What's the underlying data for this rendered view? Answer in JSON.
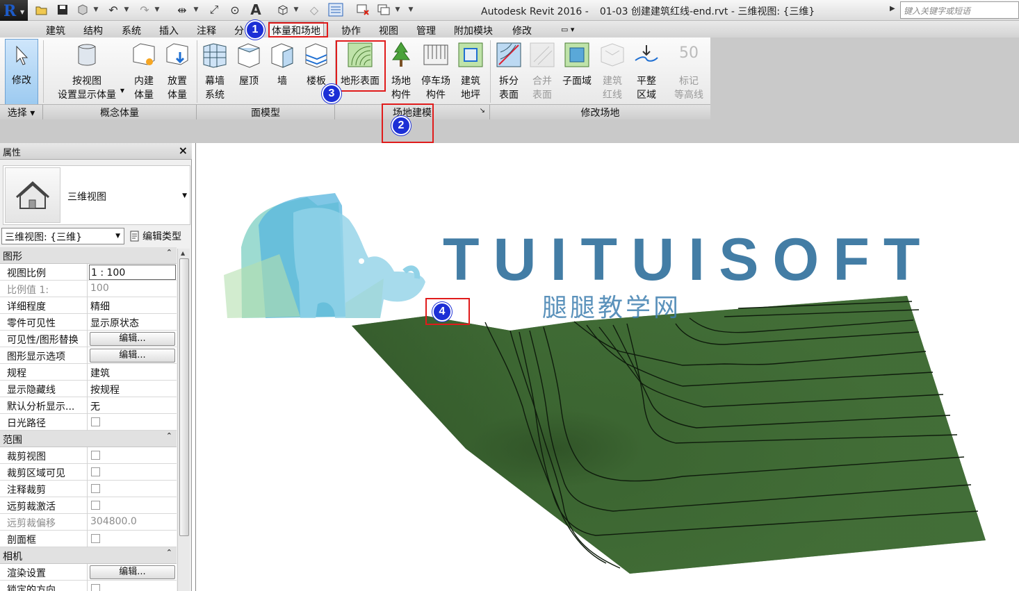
{
  "titlebar": {
    "app_name": "Autodesk Revit 2016 -",
    "file": "01-03 创建建筑红线-end.rvt - 三维视图: {三维}",
    "search_placeholder": "键入关键字或短语"
  },
  "menu_tabs": [
    "建筑",
    "结构",
    "系统",
    "插入",
    "注释",
    "分",
    "体量和场地",
    "协作",
    "视图",
    "管理",
    "附加模块",
    "修改"
  ],
  "ribbon": {
    "modify": "修改",
    "select_group": "选择",
    "conceptual_mass": {
      "group": "概念体量",
      "show_mass": [
        "按视图",
        "设置显示体量"
      ],
      "inplace_mass": [
        "内建",
        "体量"
      ],
      "place_mass": [
        "放置",
        "体量"
      ]
    },
    "face_model": {
      "group": "面模型",
      "curtain": [
        "幕墙",
        "系统"
      ],
      "roof": "屋顶",
      "wall": "墙",
      "floor": "楼板"
    },
    "site_modeling": {
      "group": "场地建模",
      "toposurface": "地形表面",
      "site_component": [
        "场地",
        "构件"
      ],
      "parking": [
        "停车场",
        "构件"
      ],
      "pad": [
        "建筑",
        "地坪"
      ]
    },
    "modify_site": {
      "group": "修改场地",
      "split": [
        "拆分",
        "表面"
      ],
      "merge": [
        "合并",
        "表面"
      ],
      "subregion": "子面域",
      "property_line": [
        "建筑",
        "红线"
      ],
      "grade": [
        "平整",
        "区域"
      ],
      "label_contours": [
        "标记",
        "等高线"
      ],
      "label_number": "50"
    }
  },
  "properties": {
    "title": "属性",
    "type_name": "三维视图",
    "view_selector": "三维视图: {三维}",
    "edit_type": "编辑类型",
    "groups": {
      "graphics": "图形",
      "extents": "范围",
      "camera": "相机"
    },
    "rows": {
      "view_scale": {
        "k": "视图比例",
        "v": "1 : 100"
      },
      "scale_value": {
        "k": "比例值 1:",
        "v": "100"
      },
      "detail_level": {
        "k": "详细程度",
        "v": "精细"
      },
      "parts_visibility": {
        "k": "零件可见性",
        "v": "显示原状态"
      },
      "vg_overrides": {
        "k": "可见性/图形替换",
        "v": "编辑..."
      },
      "graphic_display": {
        "k": "图形显示选项",
        "v": "编辑..."
      },
      "discipline": {
        "k": "规程",
        "v": "建筑"
      },
      "hidden_lines": {
        "k": "显示隐藏线",
        "v": "按规程"
      },
      "analysis_display": {
        "k": "默认分析显示...",
        "v": "无"
      },
      "sun_path": {
        "k": "日光路径"
      },
      "crop_view": {
        "k": "裁剪视图"
      },
      "crop_visible": {
        "k": "裁剪区域可见"
      },
      "annotation_crop": {
        "k": "注释裁剪"
      },
      "far_clip": {
        "k": "远剪裁激活"
      },
      "far_clip_offset": {
        "k": "远剪裁偏移",
        "v": "304800.0"
      },
      "section_box": {
        "k": "剖面框"
      },
      "render_settings": {
        "k": "渲染设置",
        "v": "编辑..."
      },
      "locked_orientation": {
        "k": "锁定的方向"
      }
    }
  },
  "watermark": {
    "brand": "TUITUISOFT",
    "subtitle": "腿腿教学网"
  },
  "callouts": [
    "1",
    "2",
    "3",
    "4"
  ],
  "colors": {
    "terrain": "#3f6a34",
    "callout": "#1c2fd6",
    "highlight_box": "#e01b1b",
    "brand_text": "#2f6f9c"
  }
}
